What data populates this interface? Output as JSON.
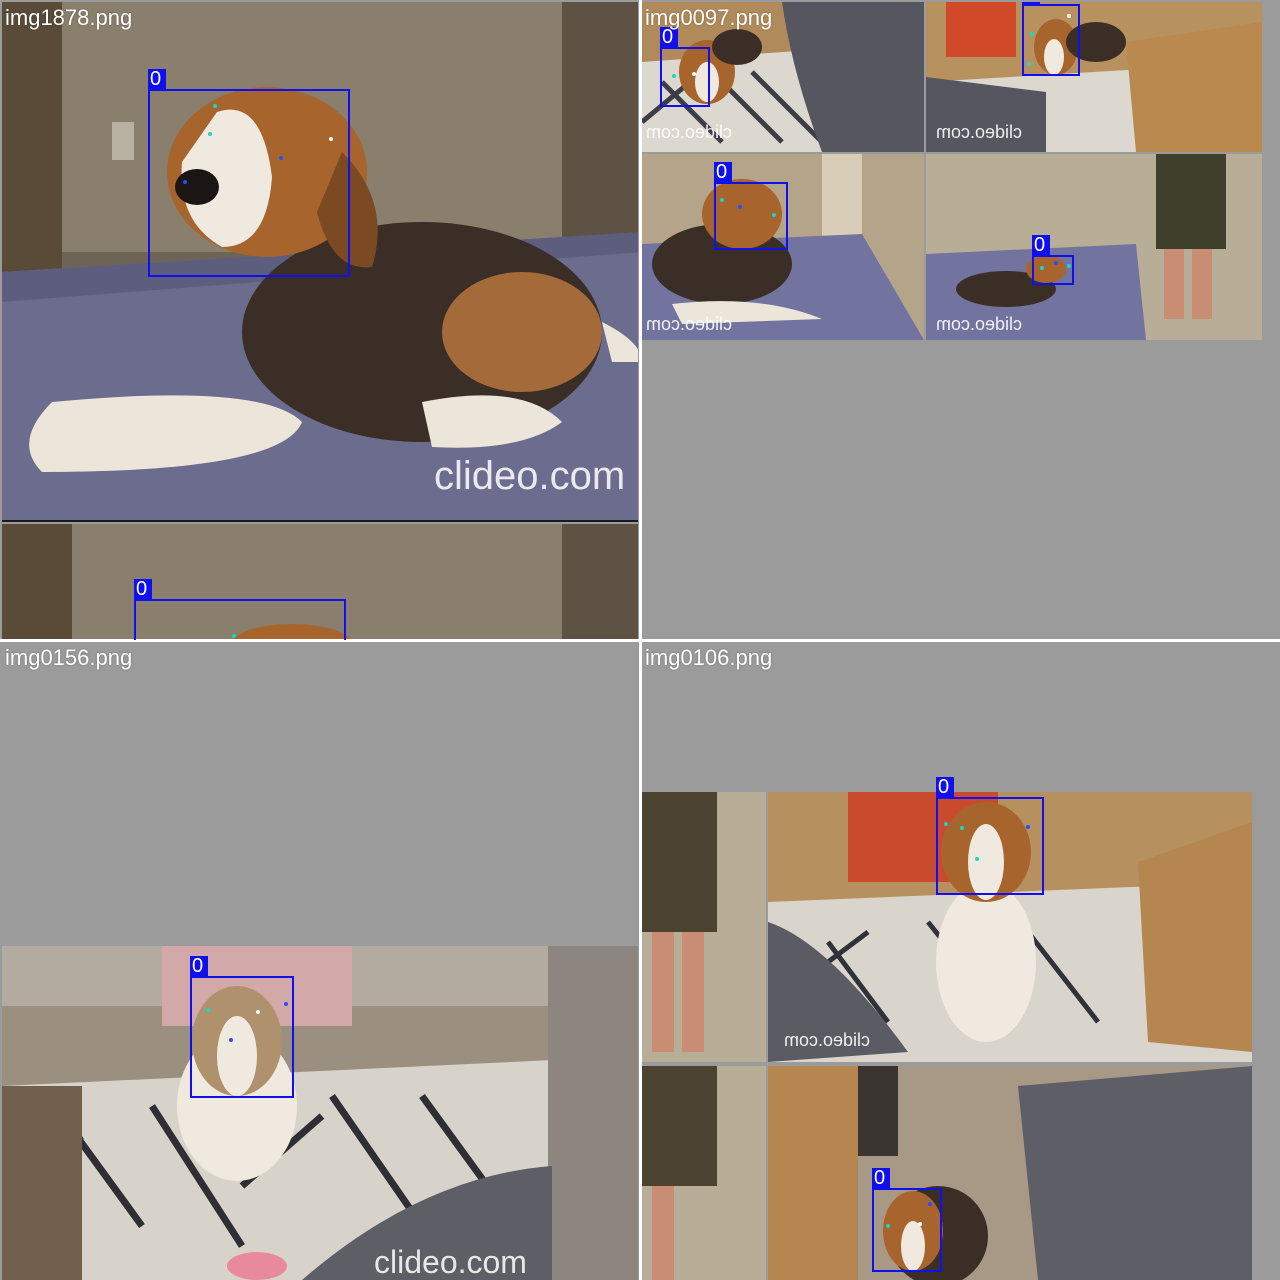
{
  "tiles": [
    {
      "filename": "img1878.png",
      "box_labels": [
        "0",
        "0"
      ],
      "watermark": "clideo.com"
    },
    {
      "filename": "img0097.png",
      "box_labels": [
        "0",
        "0",
        "0",
        "0"
      ],
      "watermark": "clideo.com"
    },
    {
      "filename": "img0156.png",
      "box_labels": [
        "0"
      ],
      "watermark": "clideo.com"
    },
    {
      "filename": "img0106.png",
      "box_labels": [
        "0",
        "0"
      ],
      "watermark": "clideo.com"
    }
  ],
  "colors": {
    "box": "#1010ee",
    "keypoint_cyan": "#19d6c8",
    "keypoint_blue": "#2a4cff",
    "keypoint_white": "#ffffff",
    "pad_gray": "#9b9b9b"
  }
}
